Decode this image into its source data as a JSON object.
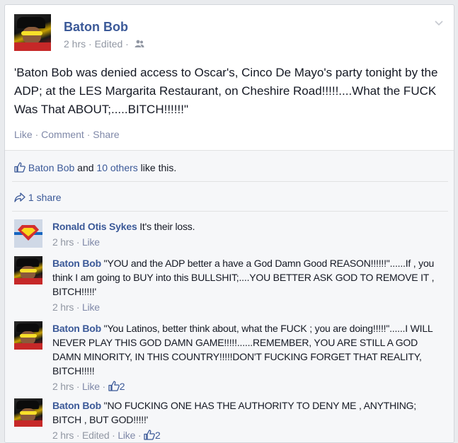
{
  "post": {
    "author": "Baton Bob",
    "time": "2 hrs",
    "edited": "Edited",
    "text": "'Baton Bob was denied access to Oscar's, Cinco De Mayo's party tonight by the ADP; at the LES Margarita Restaurant, on Cheshire Road!!!!!....What the FUCK Was That ABOUT;.....BITCH!!!!!!\"",
    "actions": {
      "like": "Like",
      "comment": "Comment",
      "share": "Share"
    }
  },
  "feedback": {
    "likes_name": "Baton Bob",
    "likes_and": " and ",
    "likes_others": "10 others",
    "likes_suffix": " like this.",
    "shares": "1 share"
  },
  "comments": [
    {
      "author": "Ronald Otis Sykes",
      "text": "It's their loss.",
      "time": "2 hrs",
      "like": "Like"
    },
    {
      "author": "Baton Bob",
      "text": "\"YOU and the ADP better a have a God Damn Good REASON!!!!!!\"......If , you think I am going to BUY into this BULLSHIT;....YOU BETTER ASK GOD TO REMOVE IT , BITCH!!!!!'",
      "time": "2 hrs",
      "like": "Like"
    },
    {
      "author": "Baton Bob",
      "text": "\"You Latinos, better think about, what the FUCK ; you are doing!!!!!\"......I WILL NEVER PLAY THIS GOD DAMN GAME!!!!!......REMEMBER, YOU ARE STILL A GOD DAMN MINORITY, IN THIS COUNTRY!!!!!DON'T FUCKING FORGET THAT REALITY, BITCH!!!!!",
      "time": "2 hrs",
      "like": "Like",
      "likes": "2"
    },
    {
      "author": "Baton Bob",
      "text": "\"NO FUCKING ONE HAS THE AUTHORITY TO DENY ME , ANYTHING; BITCH , BUT GOD!!!!!'",
      "time": "2 hrs",
      "edited": "Edited",
      "like": "Like",
      "likes": "2"
    }
  ],
  "colors": {
    "link": "#3b5998",
    "meta": "#9197a3",
    "text": "#141823"
  },
  "icons": [
    "chevron-down-icon",
    "friends-audience-icon",
    "thumbs-up-icon",
    "share-arrow-icon"
  ],
  "separator": " · "
}
